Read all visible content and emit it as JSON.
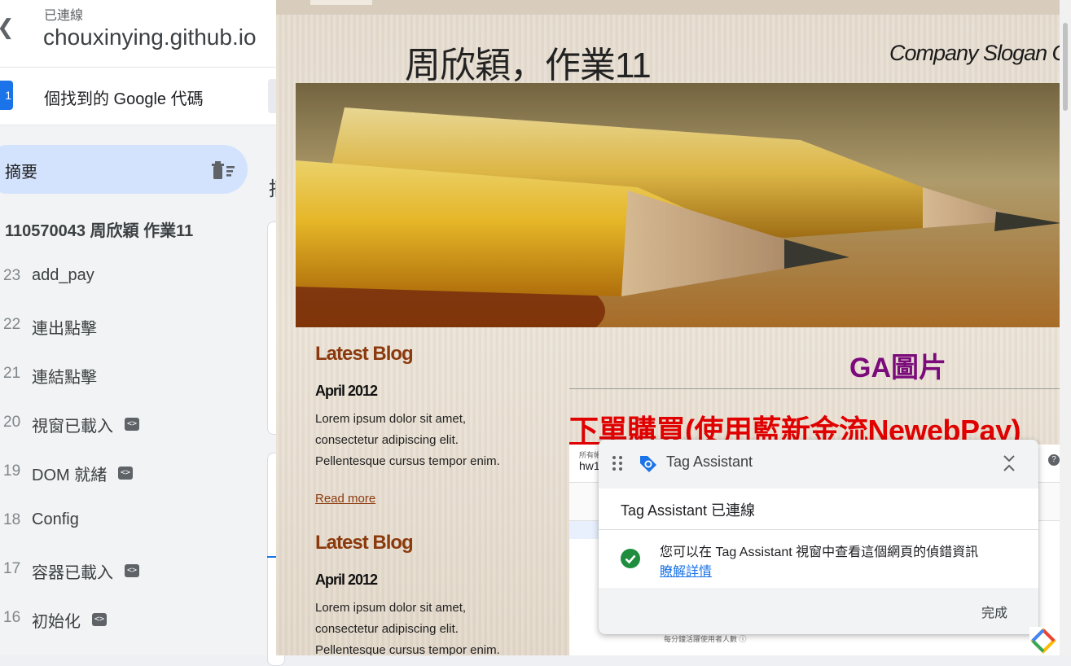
{
  "panel": {
    "connection_status": "已連線",
    "url": "chouxinying.github.io",
    "tags_found": "個找到的 Google 代碼",
    "tag_count": "1",
    "summary_label": "摘要",
    "col2_glyph": "摘",
    "events": [
      {
        "num": "",
        "label": "110570043 周欣穎 作業11",
        "code": false
      },
      {
        "num": "23",
        "label": "add_pay",
        "code": false
      },
      {
        "num": "22",
        "label": "連出點擊",
        "code": false
      },
      {
        "num": "21",
        "label": "連結點擊",
        "code": false
      },
      {
        "num": "20",
        "label": "視窗已載入",
        "code": true
      },
      {
        "num": "19",
        "label": "DOM 就緒",
        "code": true
      },
      {
        "num": "18",
        "label": "Config",
        "code": false
      },
      {
        "num": "17",
        "label": "容器已載入",
        "code": true
      },
      {
        "num": "16",
        "label": "初始化",
        "code": true
      }
    ]
  },
  "site": {
    "title": "周欣穎，作業11",
    "slogan": "Company Slogan Go",
    "blogs": [
      {
        "heading": "Latest Blog",
        "date": "April 2012",
        "text": "Lorem ipsum dolor sit amet, consectetur adipiscing elit. Pellentesque cursus tempor enim.",
        "read_more": "Read more"
      },
      {
        "heading": "Latest Blog",
        "date": "April 2012",
        "text": "Lorem ipsum dolor sit amet, consectetur adipiscing elit. Pellentesque cursus tempor enim."
      }
    ],
    "ga_heading": "GA圖片",
    "order_link": "下單購買(使用藍新金流NewebPay)",
    "ga_shot": {
      "small": "所有帳...",
      "title": "hw1",
      "footer": "每分鐘活躍使用者人數 ⓘ"
    }
  },
  "popup": {
    "title": "Tag Assistant",
    "status": "Tag Assistant 已連線",
    "message": "您可以在 Tag Assistant 視窗中查看這個網頁的偵錯資訊",
    "learn_more": "瞭解詳情",
    "done": "完成"
  },
  "colors": {
    "accent": "#1a73e8",
    "summary_bg": "#d3e3fd",
    "blog_heading": "#8b3a0e",
    "ga_heading": "#7b0a7b",
    "order_link": "#e00000",
    "success": "#1e8e3e"
  }
}
